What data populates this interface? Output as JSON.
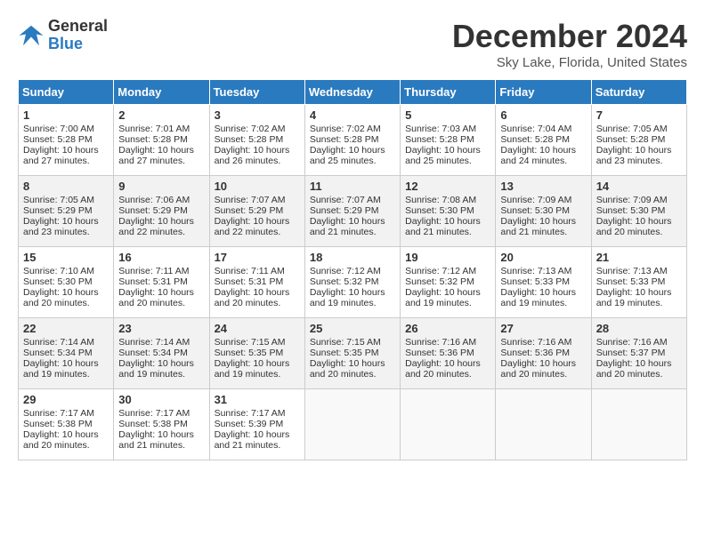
{
  "header": {
    "logo_line1": "General",
    "logo_line2": "Blue",
    "title": "December 2024",
    "location": "Sky Lake, Florida, United States"
  },
  "days_of_week": [
    "Sunday",
    "Monday",
    "Tuesday",
    "Wednesday",
    "Thursday",
    "Friday",
    "Saturday"
  ],
  "weeks": [
    [
      {
        "day": "1",
        "sunrise": "7:00 AM",
        "sunset": "5:28 PM",
        "daylight": "10 hours and 27 minutes."
      },
      {
        "day": "2",
        "sunrise": "7:01 AM",
        "sunset": "5:28 PM",
        "daylight": "10 hours and 27 minutes."
      },
      {
        "day": "3",
        "sunrise": "7:02 AM",
        "sunset": "5:28 PM",
        "daylight": "10 hours and 26 minutes."
      },
      {
        "day": "4",
        "sunrise": "7:02 AM",
        "sunset": "5:28 PM",
        "daylight": "10 hours and 25 minutes."
      },
      {
        "day": "5",
        "sunrise": "7:03 AM",
        "sunset": "5:28 PM",
        "daylight": "10 hours and 25 minutes."
      },
      {
        "day": "6",
        "sunrise": "7:04 AM",
        "sunset": "5:28 PM",
        "daylight": "10 hours and 24 minutes."
      },
      {
        "day": "7",
        "sunrise": "7:05 AM",
        "sunset": "5:28 PM",
        "daylight": "10 hours and 23 minutes."
      }
    ],
    [
      {
        "day": "8",
        "sunrise": "7:05 AM",
        "sunset": "5:29 PM",
        "daylight": "10 hours and 23 minutes."
      },
      {
        "day": "9",
        "sunrise": "7:06 AM",
        "sunset": "5:29 PM",
        "daylight": "10 hours and 22 minutes."
      },
      {
        "day": "10",
        "sunrise": "7:07 AM",
        "sunset": "5:29 PM",
        "daylight": "10 hours and 22 minutes."
      },
      {
        "day": "11",
        "sunrise": "7:07 AM",
        "sunset": "5:29 PM",
        "daylight": "10 hours and 21 minutes."
      },
      {
        "day": "12",
        "sunrise": "7:08 AM",
        "sunset": "5:30 PM",
        "daylight": "10 hours and 21 minutes."
      },
      {
        "day": "13",
        "sunrise": "7:09 AM",
        "sunset": "5:30 PM",
        "daylight": "10 hours and 21 minutes."
      },
      {
        "day": "14",
        "sunrise": "7:09 AM",
        "sunset": "5:30 PM",
        "daylight": "10 hours and 20 minutes."
      }
    ],
    [
      {
        "day": "15",
        "sunrise": "7:10 AM",
        "sunset": "5:30 PM",
        "daylight": "10 hours and 20 minutes."
      },
      {
        "day": "16",
        "sunrise": "7:11 AM",
        "sunset": "5:31 PM",
        "daylight": "10 hours and 20 minutes."
      },
      {
        "day": "17",
        "sunrise": "7:11 AM",
        "sunset": "5:31 PM",
        "daylight": "10 hours and 20 minutes."
      },
      {
        "day": "18",
        "sunrise": "7:12 AM",
        "sunset": "5:32 PM",
        "daylight": "10 hours and 19 minutes."
      },
      {
        "day": "19",
        "sunrise": "7:12 AM",
        "sunset": "5:32 PM",
        "daylight": "10 hours and 19 minutes."
      },
      {
        "day": "20",
        "sunrise": "7:13 AM",
        "sunset": "5:33 PM",
        "daylight": "10 hours and 19 minutes."
      },
      {
        "day": "21",
        "sunrise": "7:13 AM",
        "sunset": "5:33 PM",
        "daylight": "10 hours and 19 minutes."
      }
    ],
    [
      {
        "day": "22",
        "sunrise": "7:14 AM",
        "sunset": "5:34 PM",
        "daylight": "10 hours and 19 minutes."
      },
      {
        "day": "23",
        "sunrise": "7:14 AM",
        "sunset": "5:34 PM",
        "daylight": "10 hours and 19 minutes."
      },
      {
        "day": "24",
        "sunrise": "7:15 AM",
        "sunset": "5:35 PM",
        "daylight": "10 hours and 19 minutes."
      },
      {
        "day": "25",
        "sunrise": "7:15 AM",
        "sunset": "5:35 PM",
        "daylight": "10 hours and 20 minutes."
      },
      {
        "day": "26",
        "sunrise": "7:16 AM",
        "sunset": "5:36 PM",
        "daylight": "10 hours and 20 minutes."
      },
      {
        "day": "27",
        "sunrise": "7:16 AM",
        "sunset": "5:36 PM",
        "daylight": "10 hours and 20 minutes."
      },
      {
        "day": "28",
        "sunrise": "7:16 AM",
        "sunset": "5:37 PM",
        "daylight": "10 hours and 20 minutes."
      }
    ],
    [
      {
        "day": "29",
        "sunrise": "7:17 AM",
        "sunset": "5:38 PM",
        "daylight": "10 hours and 20 minutes."
      },
      {
        "day": "30",
        "sunrise": "7:17 AM",
        "sunset": "5:38 PM",
        "daylight": "10 hours and 21 minutes."
      },
      {
        "day": "31",
        "sunrise": "7:17 AM",
        "sunset": "5:39 PM",
        "daylight": "10 hours and 21 minutes."
      },
      null,
      null,
      null,
      null
    ]
  ]
}
